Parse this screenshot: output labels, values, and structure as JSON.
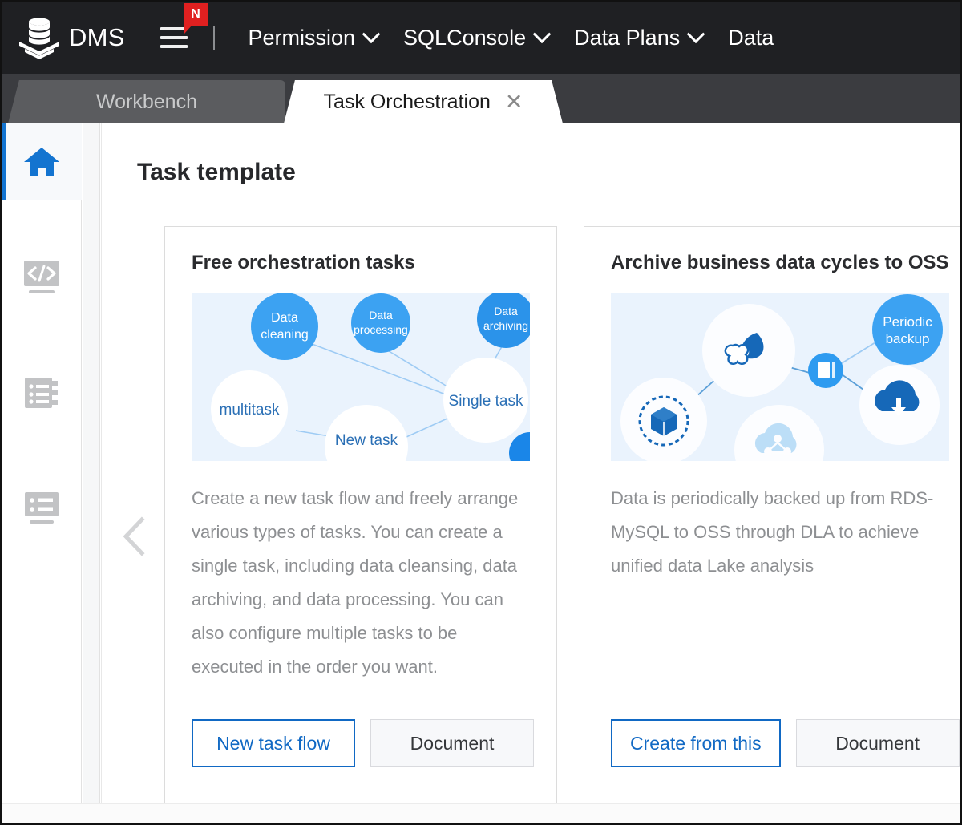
{
  "topnav": {
    "brand": "DMS",
    "logo_icon": "database-stack-icon",
    "menu_icon": "hamburger-menu-icon",
    "badge": "N",
    "items": [
      {
        "label": "Permission",
        "caret": true
      },
      {
        "label": "SQLConsole",
        "caret": true
      },
      {
        "label": "Data Plans",
        "caret": true
      },
      {
        "label": "Data",
        "caret": false
      }
    ],
    "bg_color": "#1f2023",
    "badge_color": "#e02020"
  },
  "tabs": [
    {
      "label": "Workbench",
      "active": false,
      "closable": false
    },
    {
      "label": "Task Orchestration",
      "active": true,
      "closable": true,
      "close_icon": "close-icon"
    }
  ],
  "sidebar": {
    "items": [
      {
        "icon": "home-icon",
        "active": true
      },
      {
        "icon": "code-icon",
        "active": false
      },
      {
        "icon": "document-list-icon",
        "active": false
      },
      {
        "icon": "list-icon",
        "active": false
      }
    ],
    "active_color": "#1374d0",
    "inactive_color": "#c2c3c5"
  },
  "main": {
    "page_title": "Task template",
    "carousel_prev_icon": "chevron-left-icon",
    "cards": [
      {
        "title": "Free orchestration tasks",
        "description": "Create a new task flow and freely arrange various types of tasks. You can create a single task, including data cleansing, data archiving, and data processing. You can also configure multiple tasks to be executed in the order you want.",
        "primary_button": "New task flow",
        "secondary_button": "Document",
        "illustration": {
          "type": "node-graph",
          "bg_color": "#eaf3fd",
          "accent_color": "#3ca2f2",
          "nodes": [
            {
              "label": "Data cleaning",
              "style": "blue"
            },
            {
              "label": "Data processing",
              "style": "blue"
            },
            {
              "label": "Data archiving",
              "style": "blue"
            },
            {
              "label": "multitask",
              "style": "white"
            },
            {
              "label": "New task",
              "style": "white"
            },
            {
              "label": "Single task",
              "style": "white"
            }
          ]
        }
      },
      {
        "title": "Archive business data cycles to OSS",
        "description": "Data is periodically backed up from RDS-MySQL to OSS through DLA to achieve unified data Lake analysis",
        "primary_button": "Create from this",
        "secondary_button": "Document",
        "illustration": {
          "type": "node-graph",
          "bg_color": "#eaf3fd",
          "accent_color": "#3ca2f2",
          "nodes": [
            {
              "label": "Periodic backup",
              "style": "blue"
            },
            {
              "label": "",
              "style": "white",
              "icon": "mysql-dolphin-icon"
            },
            {
              "label": "",
              "style": "white",
              "icon": "dla-cube-icon"
            },
            {
              "label": "",
              "style": "blue",
              "icon": "archive-icon"
            },
            {
              "label": "",
              "style": "white",
              "icon": "oss-cloud-upload-icon"
            },
            {
              "label": "",
              "style": "white",
              "icon": "network-cloud-icon"
            }
          ]
        }
      }
    ]
  }
}
